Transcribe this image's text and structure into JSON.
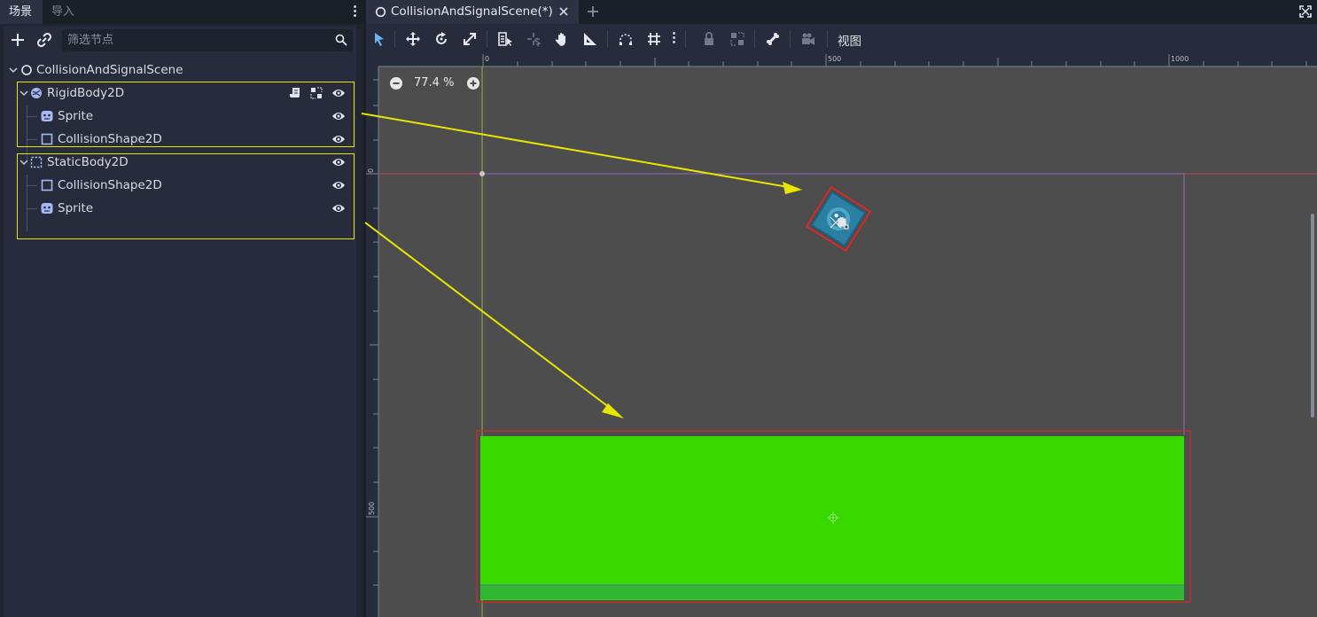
{
  "dock": {
    "tabs": [
      "场景",
      "导入"
    ],
    "filter_placeholder": "筛选节点"
  },
  "tree": {
    "root": "CollisionAndSignalScene",
    "rigid": "RigidBody2D",
    "rigid_sprite": "Sprite",
    "rigid_shape": "CollisionShape2D",
    "static": "StaticBody2D",
    "static_shape": "CollisionShape2D",
    "static_sprite": "Sprite"
  },
  "editor": {
    "scene_tab": "CollisionAndSignalScene(*)",
    "view_menu": "视图",
    "zoom": "77.4 %",
    "ruler_top": [
      "0",
      "500",
      "1000"
    ],
    "ruler_left": [
      "0",
      "500"
    ]
  },
  "colors": {
    "annotation": "#e8e600",
    "collision": "#d42a2a",
    "ground": "#39d900",
    "sprite": "#2b7fa3",
    "node_icon_2d": "#a5b7f3"
  }
}
